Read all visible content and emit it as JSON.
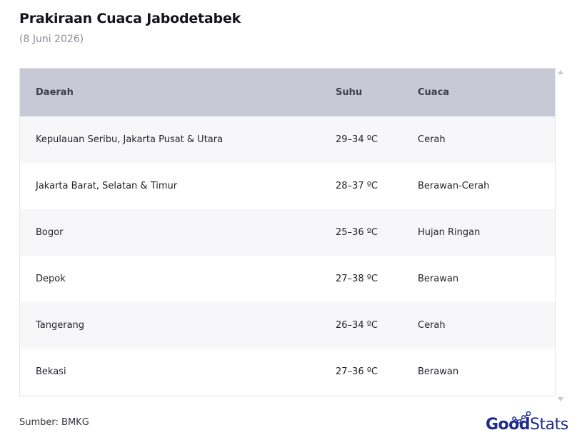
{
  "title": "Prakiraan Cuaca Jabodetabek",
  "subtitle": "(8 Juni 2026)",
  "table": {
    "headers": [
      "Daerah",
      "Suhu",
      "Cuaca"
    ],
    "rows": [
      [
        "Kepulauan Seribu, Jakarta Pusat & Utara",
        "29–34 ºC",
        "Cerah"
      ],
      [
        "Jakarta Barat, Selatan & Timur",
        "28–37 ºC",
        "Berawan-Cerah"
      ],
      [
        "Bogor",
        "25–36 ºC",
        "Hujan Ringan"
      ],
      [
        "Depok",
        "27–38 ºC",
        "Berawan"
      ],
      [
        "Tangerang",
        "26–34 ºC",
        "Cerah"
      ],
      [
        "Bekasi",
        "27–36 ºC",
        "Berawan"
      ]
    ]
  },
  "source": "Sumber: BMKG",
  "logo": {
    "bold": "Good",
    "light": "Stats"
  },
  "colors": {
    "header_bg": "#c8c9d6",
    "logo": "#1f2c8a"
  }
}
